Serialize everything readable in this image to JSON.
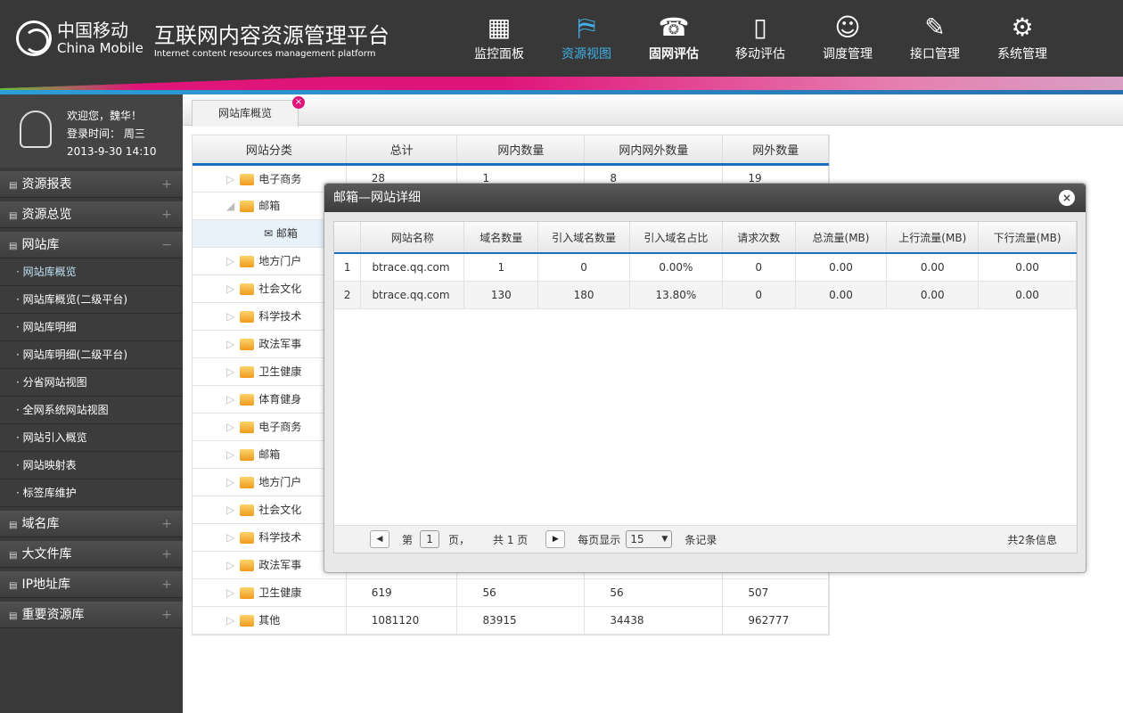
{
  "header": {
    "logo_cn": "中国移动",
    "logo_en": "China Mobile",
    "title": "互联网内容资源管理平台",
    "subtitle": "Internet content resources management platform",
    "nav": [
      {
        "label": "监控面板",
        "icon": "monitor-panel-icon",
        "glyph": "▦"
      },
      {
        "label": "资源视图",
        "icon": "map-icon",
        "glyph": "⛿",
        "active": true
      },
      {
        "label": "固网评估",
        "icon": "telephone-icon",
        "glyph": "☎"
      },
      {
        "label": "移动评估",
        "icon": "mobile-phone-icon",
        "glyph": "▯"
      },
      {
        "label": "调度管理",
        "icon": "headset-icon",
        "glyph": "☺"
      },
      {
        "label": "接口管理",
        "icon": "document-icon",
        "glyph": "✎"
      },
      {
        "label": "系统管理",
        "icon": "gears-icon",
        "glyph": "⚙"
      }
    ]
  },
  "user": {
    "welcome": "欢迎您，魏华！",
    "login_label": "登录时间：  周三",
    "login_time": "2013-9-30   14:10"
  },
  "sidebar": {
    "sections": [
      {
        "label": "资源报表",
        "toggle": "+"
      },
      {
        "label": "资源总览",
        "toggle": "+"
      },
      {
        "label": "网站库",
        "toggle": "−"
      }
    ],
    "items": [
      "网站库概览",
      "网站库概览(二级平台)",
      "网站库明细",
      "网站库明细(二级平台)",
      "分省网站视图",
      "全网系统网站视图",
      "网站引入概览",
      "网站映射表",
      "标签库维护"
    ],
    "sections_after": [
      {
        "label": "域名库",
        "toggle": "+"
      },
      {
        "label": "大文件库",
        "toggle": "+"
      },
      {
        "label": "IP地址库",
        "toggle": "+"
      },
      {
        "label": "重要资源库",
        "toggle": "+"
      }
    ]
  },
  "tab": {
    "label": "网站库概览",
    "close": "×"
  },
  "grid": {
    "columns": [
      "网站分类",
      "总计",
      "网内数量",
      "网内网外数量",
      "网外数量"
    ],
    "rows": [
      [
        "电子商务",
        "28",
        "1",
        "8",
        "19"
      ],
      [
        "邮箱",
        "",
        "",
        "",
        ""
      ],
      [
        "邮箱",
        "",
        "",
        "",
        ""
      ],
      [
        "地方门户",
        "",
        "",
        "",
        ""
      ],
      [
        "社会文化",
        "",
        "",
        "",
        ""
      ],
      [
        "科学技术",
        "",
        "",
        "",
        ""
      ],
      [
        "政法军事",
        "",
        "",
        "",
        ""
      ],
      [
        "卫生健康",
        "",
        "",
        "",
        ""
      ],
      [
        "体育健身",
        "",
        "",
        "",
        ""
      ],
      [
        "电子商务",
        "",
        "",
        "",
        ""
      ],
      [
        "邮箱",
        "",
        "",
        "",
        ""
      ],
      [
        "地方门户",
        "",
        "",
        "",
        ""
      ],
      [
        "社会文化",
        "",
        "",
        "",
        ""
      ],
      [
        "科学技术",
        "",
        "",
        "",
        ""
      ],
      [
        "政法军事",
        "",
        "",
        "",
        ""
      ],
      [
        "卫生健康",
        "619",
        "56",
        "56",
        "507"
      ],
      [
        "其他",
        "1081120",
        "83915",
        "34438",
        "962777"
      ]
    ]
  },
  "modal": {
    "title": "邮箱—网站详细",
    "close": "×",
    "columns": [
      "",
      "网站名称",
      "域名数量",
      "引入域名数量",
      "引入域名占比",
      "请求次数",
      "总流量(MB)",
      "上行流量(MB)",
      "下行流量(MB)"
    ],
    "rows": [
      [
        "1",
        "btrace.qq.com",
        "1",
        "0",
        "0.00%",
        "0",
        "0.00",
        "0.00",
        "0.00"
      ],
      [
        "2",
        "btrace.qq.com",
        "130",
        "180",
        "13.80%",
        "0",
        "0.00",
        "0.00",
        "0.00"
      ]
    ],
    "pager": {
      "prev": "◀",
      "page_prefix": "第",
      "page": "1",
      "page_suffix": "页，",
      "total_pages": "共 1 页",
      "next": "▶",
      "per_page_label": "每页显示",
      "per_page": "15",
      "records_label": "条记录",
      "total": "共2条信息"
    }
  }
}
